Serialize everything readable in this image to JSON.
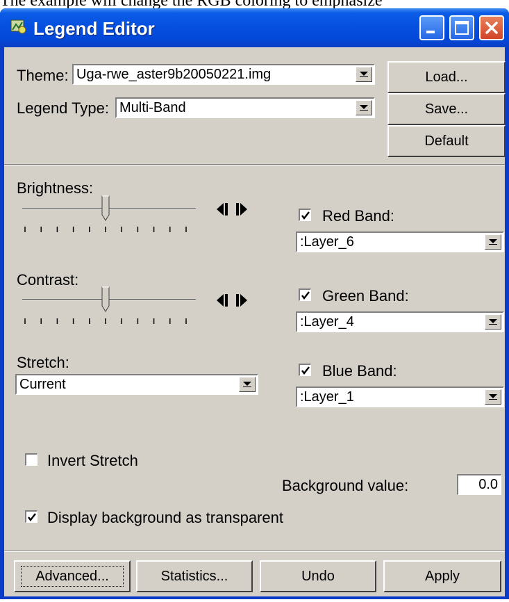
{
  "document_text": "The example will change the RGB coloring to emphasize",
  "window": {
    "title": "Legend Editor",
    "icon": "legend-editor-app-icon",
    "controls": [
      "minimize-icon",
      "maximize-icon",
      "close-icon"
    ]
  },
  "theme": {
    "label": "Theme:",
    "value": "Uga-rwe_aster9b20050221.img"
  },
  "legend_type": {
    "label": "Legend Type:",
    "value": "Multi-Band"
  },
  "buttons_top": {
    "load": "Load...",
    "save": "Save...",
    "default": "Default"
  },
  "brightness": {
    "label": "Brightness:",
    "level": 0.5
  },
  "contrast": {
    "label": "Contrast:",
    "level": 0.5
  },
  "stretch": {
    "label": "Stretch:",
    "value": "Current"
  },
  "bands": {
    "red": {
      "label": "Red Band:",
      "checked": true,
      "value": ":Layer_6"
    },
    "green": {
      "label": "Green Band:",
      "checked": true,
      "value": ":Layer_4"
    },
    "blue": {
      "label": "Blue Band:",
      "checked": true,
      "value": ":Layer_1"
    }
  },
  "invert_stretch": {
    "label": "Invert Stretch",
    "checked": false
  },
  "background_value": {
    "label": "Background value:",
    "value": "0.0"
  },
  "display_transparent": {
    "label": "Display background as transparent",
    "checked": true
  },
  "buttons_bottom": {
    "advanced": "Advanced...",
    "statistics": "Statistics...",
    "undo": "Undo",
    "apply": "Apply"
  }
}
